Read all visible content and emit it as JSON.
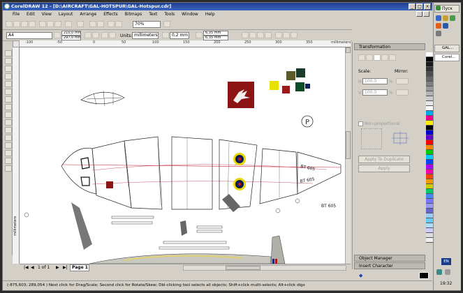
{
  "window": {
    "title": "CorelDRAW 12 - [D:\\AIRCRAFT\\GAL-HOTSPUR\\GAL-Hotspur.cdr]",
    "controls": [
      "_",
      "□",
      "×"
    ]
  },
  "menu": [
    "File",
    "Edit",
    "View",
    "Layout",
    "Arrange",
    "Effects",
    "Bitmaps",
    "Text",
    "Tools",
    "Window",
    "Help"
  ],
  "standard_toolbar": {
    "zoom": "70%"
  },
  "property_bar": {
    "paper": "A4",
    "width": "210,0 mm",
    "height": "297,0 mm",
    "units_label": "Units:",
    "units_value": "millimeters",
    "nudge": "0,2 mm",
    "dup_x": "6,35 mm",
    "dup_y": "6,35 mm",
    "dup_sep": "6,35 mm"
  },
  "rulers": {
    "h_ticks": [
      "-100",
      "-50",
      "0",
      "50",
      "100",
      "150",
      "200",
      "250",
      "300",
      "350"
    ],
    "h_unit": "millimeters",
    "v_unit": "millimeters"
  },
  "page_nav": {
    "page_count": "1 of 1",
    "tab": "Page 1"
  },
  "docker": {
    "title": "Transformation",
    "scale_label": "Scale:",
    "mirror_label": "Mirror:",
    "h_value": "100,0",
    "v_value": "100,0",
    "percent": "%",
    "h_axis": "H:",
    "v_axis": "V:",
    "nonprop": "Non-proportional",
    "apply_dup": "Apply To Duplicate",
    "apply": "Apply",
    "object_manager": "Object Manager",
    "insert_character": "Insert Character"
  },
  "canvas": {
    "serial_1": "BT 605",
    "serial_2": "BT 605",
    "serial_3": "BT 605",
    "p_mark": "P"
  },
  "palette": [
    "#ffffff",
    "#000000",
    "#1a1a1a",
    "#333333",
    "#4d4d4d",
    "#666666",
    "#808080",
    "#999999",
    "#b3b3b3",
    "#cccccc",
    "#e6e6e6",
    "#ffffff",
    "#00aaee",
    "#ee0088",
    "#ffee00",
    "#000000",
    "#0000cc",
    "#6600cc",
    "#ff0000",
    "#ff8800",
    "#00cc00",
    "#00ccff",
    "#0044ff",
    "#aa00ff",
    "#ff00aa",
    "#ff4400",
    "#ff9900",
    "#cccc00",
    "#00cc66",
    "#4488ff",
    "#7777ff",
    "#9999ff",
    "#6666cc",
    "#99ccff",
    "#66ccff",
    "#aaddff",
    "#ccccff",
    "#dddddd",
    "#eeeeee"
  ],
  "status": "(-875,603; 289,054 )   Next click for Drag/Scale; Second click for Rotate/Skew; Dbl-clicking tool selects all objects; Shift+click multi-selects; Alt+click digs",
  "taskbar": {
    "start": "Пуск",
    "items": [
      "GAL...",
      "Corel..."
    ],
    "lang": "EN",
    "clock": "19:32"
  }
}
